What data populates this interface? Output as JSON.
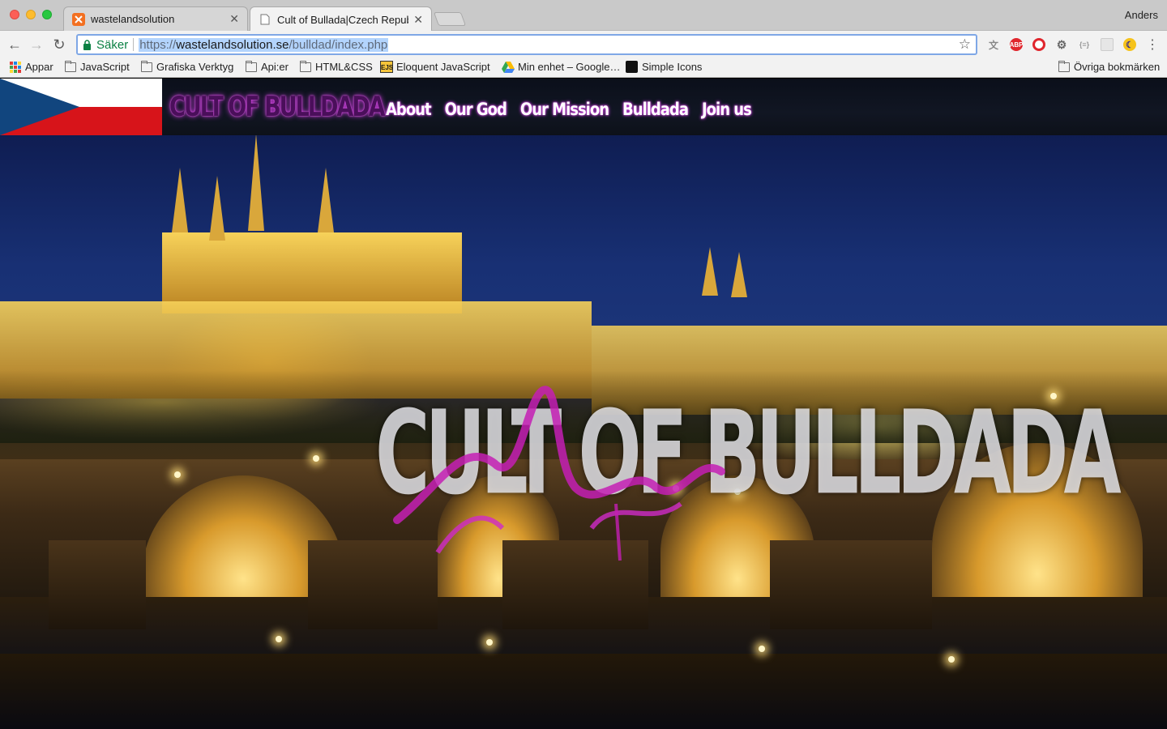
{
  "browser": {
    "tabs": [
      {
        "label": "wastelandsolution",
        "favicon": "xampp-icon",
        "active": false
      },
      {
        "label": "Cult of Bullada|Czech Republic",
        "favicon": "page-icon",
        "active": true
      }
    ],
    "profile_name": "Anders",
    "address": {
      "secure_label": "Säker",
      "url_scheme": "https://",
      "url_host": "wastelandsolution.se",
      "url_path": "/bulldad/index.php"
    },
    "extensions": [
      "translate-icon",
      "adblock-icon",
      "opera-icon",
      "gear-extension-icon",
      "json-icon",
      "grid-extension-icon",
      "moon-icon"
    ],
    "bookmarks": [
      {
        "label": "Appar",
        "icon": "apps-grid-icon"
      },
      {
        "label": "JavaScript",
        "icon": "folder-icon"
      },
      {
        "label": "Grafiska Verktyg",
        "icon": "folder-icon"
      },
      {
        "label": "Api:er",
        "icon": "folder-icon"
      },
      {
        "label": "HTML&CSS",
        "icon": "folder-icon"
      },
      {
        "label": "Eloquent JavaScript",
        "icon": "ejs-icon"
      },
      {
        "label": "Min enhet – Google…",
        "icon": "google-drive-icon"
      },
      {
        "label": "Simple Icons",
        "icon": "simple-icons-icon"
      }
    ],
    "other_bookmarks": "Övriga bokmärken"
  },
  "site": {
    "brand": "CULT OF BULLDADA",
    "nav": [
      "About",
      "Our God",
      "Our Mission",
      "Bulldada",
      "Join us"
    ],
    "hero_title": "CULT OF BULLDADA",
    "colors": {
      "accent_glow": "#d33be6",
      "header_bg": "#111623",
      "flag_white": "#ffffff",
      "flag_red": "#d7141a",
      "flag_blue": "#11457e"
    }
  }
}
